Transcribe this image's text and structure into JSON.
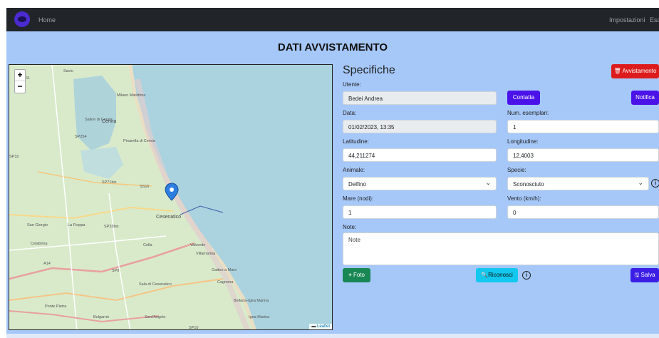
{
  "navbar": {
    "logo": "fish-logo",
    "home": "Home",
    "settings": "Impostazioni",
    "exit": "Esc"
  },
  "page": {
    "title": "DATI AVVISTAMENTO"
  },
  "map": {
    "zoom_in": "+",
    "zoom_out": "−",
    "attribution": "Leaflet",
    "labels": [
      "Savio",
      "Milano Marittima",
      "Cervia",
      "Saline di Cervia",
      "SP254",
      "Pinarella di Cervia",
      "SP71bis",
      "SS16",
      "Cesenatico",
      "San Giorgio",
      "La Fioppa",
      "SP33bis",
      "Celabrina",
      "Cella",
      "Valverde",
      "Villamarina",
      "A14",
      "SP8",
      "Sala di Cesenatico",
      "Gatteo a Mare",
      "Cagnona",
      "Bellaria-Igea Marina",
      "Igea Marina",
      "Ponte Pietra",
      "Bulgarnò",
      "Sant'Angelo",
      "SP10",
      "SP32",
      "SP11"
    ],
    "marker_icon": "map-pin-icon"
  },
  "form": {
    "title": "Specifiche",
    "delete_button": "Avvistamento",
    "utente_label": "Utente:",
    "utente_value": "Bedei Andrea",
    "contact_button": "Contatta",
    "notify_button": "Notifica",
    "data_label": "Data:",
    "data_value": "01/02/2023, 13:35",
    "num_label": "Num. esemplari:",
    "num_value": "1",
    "lat_label": "Latitudine:",
    "lat_value": "44,211274",
    "lon_label": "Longitudine:",
    "lon_value": "12,4003",
    "animale_label": "Animale:",
    "animale_value": "Delfino",
    "specie_label": "Specie:",
    "specie_value": "Sconosciuto",
    "mare_label": "Mare (nodi):",
    "mare_value": "1",
    "vento_label": "Vento (km/h):",
    "vento_value": "0",
    "note_label": "Note:",
    "note_placeholder": "Note",
    "photo_button": "Foto",
    "recognize_button": "Riconosci",
    "save_button": "Salva"
  }
}
